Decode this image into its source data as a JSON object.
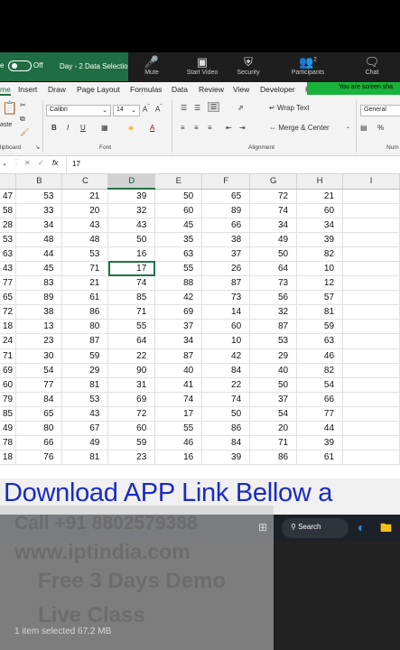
{
  "titlebar": {
    "autosave_label": "e",
    "toggle_state": "Off",
    "document_title": "Day - 2 Data Selection"
  },
  "zoom_controls": [
    {
      "label": "Mute",
      "icon": "microphone-icon"
    },
    {
      "label": "Start Video",
      "icon": "video-camera-icon"
    },
    {
      "label": "Security",
      "icon": "shield-icon"
    },
    {
      "label": "Participants",
      "icon": "people-icon",
      "count": "2"
    },
    {
      "label": "Chat",
      "icon": "chat-bubble-icon"
    }
  ],
  "share_banner": "You are screen sha",
  "ribbon_tabs": [
    "me",
    "Insert",
    "Draw",
    "Page Layout",
    "Formulas",
    "Data",
    "Review",
    "View",
    "Developer",
    "H"
  ],
  "ribbon": {
    "paste_label": "aste",
    "clipboard_label": "lipboard",
    "font_name": "Calibri",
    "font_size": "14",
    "font_label": "Font",
    "alignment_label": "Alignment",
    "wrap_text": "Wrap Text",
    "merge_center": "Merge & Center",
    "number_format": "General",
    "number_label": "Num",
    "bold": "B",
    "italic": "I",
    "underline": "U",
    "font_color_letter": "A",
    "percent": "%"
  },
  "formula_bar": {
    "fx": "fx",
    "value": "17"
  },
  "sheet": {
    "columns": [
      "B",
      "C",
      "D",
      "E",
      "F",
      "G",
      "H",
      "I"
    ],
    "selected_column": "D",
    "rows": [
      [
        "47",
        "53",
        "21",
        "39",
        "50",
        "65",
        "72",
        "21"
      ],
      [
        "58",
        "33",
        "20",
        "32",
        "60",
        "89",
        "74",
        "60"
      ],
      [
        "28",
        "34",
        "43",
        "43",
        "45",
        "66",
        "34",
        "34"
      ],
      [
        "53",
        "48",
        "48",
        "50",
        "35",
        "38",
        "49",
        "39"
      ],
      [
        "63",
        "44",
        "53",
        "16",
        "63",
        "37",
        "50",
        "82"
      ],
      [
        "43",
        "45",
        "71",
        "17",
        "55",
        "26",
        "64",
        "10"
      ],
      [
        "77",
        "83",
        "21",
        "74",
        "88",
        "87",
        "73",
        "12"
      ],
      [
        "65",
        "89",
        "61",
        "85",
        "42",
        "73",
        "56",
        "57"
      ],
      [
        "72",
        "38",
        "86",
        "71",
        "69",
        "14",
        "32",
        "81"
      ],
      [
        "18",
        "13",
        "80",
        "55",
        "37",
        "60",
        "87",
        "59"
      ],
      [
        "24",
        "23",
        "87",
        "64",
        "34",
        "10",
        "53",
        "63"
      ],
      [
        "71",
        "30",
        "59",
        "22",
        "87",
        "42",
        "29",
        "46"
      ],
      [
        "69",
        "54",
        "29",
        "90",
        "40",
        "84",
        "40",
        "82"
      ],
      [
        "60",
        "77",
        "81",
        "31",
        "41",
        "22",
        "50",
        "54"
      ],
      [
        "79",
        "84",
        "53",
        "69",
        "74",
        "74",
        "37",
        "66"
      ],
      [
        "85",
        "65",
        "43",
        "72",
        "17",
        "50",
        "54",
        "77"
      ],
      [
        "49",
        "80",
        "67",
        "60",
        "55",
        "86",
        "20",
        "44"
      ],
      [
        "78",
        "66",
        "49",
        "59",
        "46",
        "84",
        "71",
        "39"
      ],
      [
        "18",
        "76",
        "81",
        "23",
        "16",
        "39",
        "86",
        "61"
      ]
    ]
  },
  "promo": {
    "download": "Download APP Link Bellow a",
    "call": "Call +91 8802579388",
    "website": "www.iptindia.com",
    "demo": "Free 3 Days Demo",
    "live": "Live Class"
  },
  "taskbar": {
    "search_label": "Search"
  },
  "explorer_status": "1 item selected  67.2 MB",
  "colors": {
    "excel_green": "#1f6e43",
    "share_green": "#18b33a",
    "download_blue": "#1b2ac4"
  }
}
